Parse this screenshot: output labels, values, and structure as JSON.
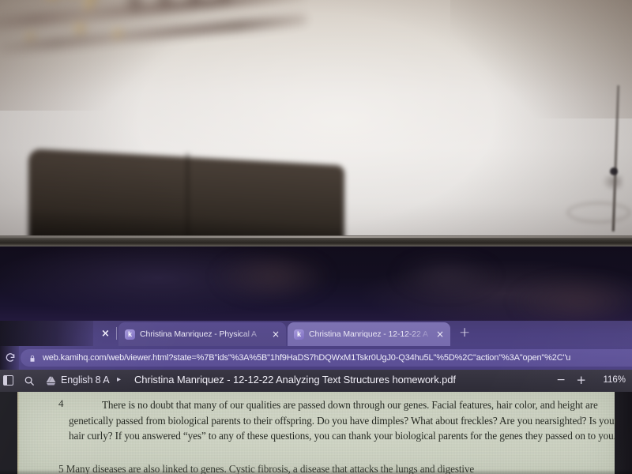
{
  "scene": {
    "description": "photo-of-monitor",
    "room_objects": [
      "wall-hanging",
      "dark-couch",
      "floor-lamp"
    ]
  },
  "browser": {
    "tabstrip": {
      "lone_close_label": "×",
      "new_tab_label": "+",
      "tabs": [
        {
          "favicon_letter": "k",
          "favicon_name": "kami-favicon",
          "title": "Christina Manriquez - Physical A",
          "close_label": "×",
          "active": false
        },
        {
          "favicon_letter": "k",
          "favicon_name": "kami-favicon",
          "title": "Christina Manriquez - 12-12-22 A",
          "close_label": "×",
          "active": true
        }
      ]
    },
    "omnibox": {
      "reload_icon": "reload-icon",
      "lock_icon": "lock-icon",
      "url": "web.kamihq.com/web/viewer.html?state=%7B\"ids\"%3A%5B\"1hf9HaDS7hDQWxM1Tskr0UgJ0-Q34hu5L\"%5D%2C\"action\"%3A\"open\"%2C\"u"
    }
  },
  "app_toolbar": {
    "panel_icon": "side-panel-icon",
    "search_icon": "search-icon",
    "drive_icon": "google-drive-icon",
    "folder_label": "English 8 A",
    "chevron_label": "▸",
    "document_name": "Christina Manriquez - 12-12-22 Analyzing Text Structures homework.pdf",
    "zoom_out_label": "−",
    "zoom_in_label": "+",
    "zoom_level": "116%"
  },
  "document": {
    "paragraphs": [
      {
        "number": "4",
        "text": "There is no doubt that many of our qualities are passed down through our genes. Facial features, hair color, and height are genetically passed from biological parents to their offspring. Do you have dimples? What about freckles? Are you nearsighted? Is your hair curly? If you answered “yes” to any of these questions, you can thank your biological parents for the genes they passed on to you."
      },
      {
        "number": "5",
        "text": "5          Many diseases are also linked to genes. Cystic fibrosis, a disease that attacks the lungs and digestive"
      }
    ]
  },
  "colors": {
    "tabstrip_bg": "#4b4080",
    "active_tab": "#7d72b2",
    "omnibox_field": "#60549b",
    "app_toolbar_bg": "#33313d",
    "page_bg": "#ccd2c2",
    "text": "#1f231c"
  }
}
